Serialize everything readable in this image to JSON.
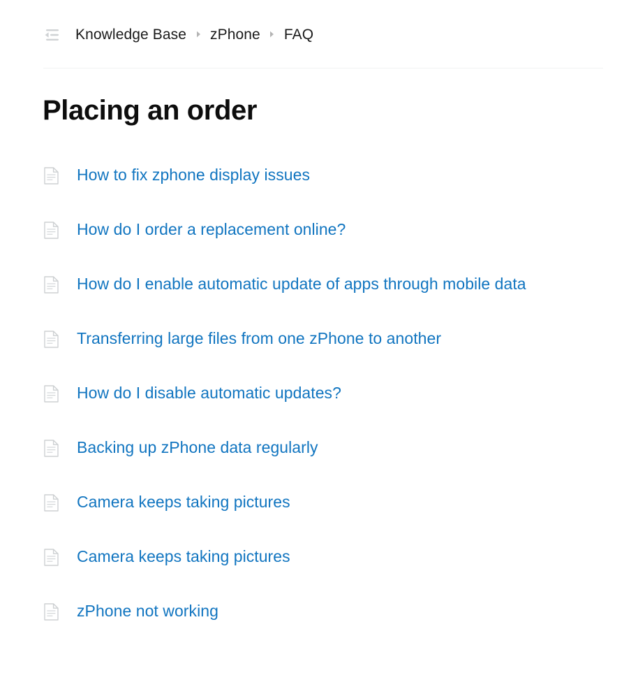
{
  "colors": {
    "link": "#1175c0",
    "text": "#1a1a1a",
    "title": "#0d0d0d",
    "icon_gray": "#c9ccce",
    "divider": "#f1f2f3",
    "separator": "#b3b3b3"
  },
  "header": {
    "sidebar_toggle_icon": "collapse-sidebar-icon",
    "breadcrumb": [
      {
        "label": "Knowledge Base"
      },
      {
        "label": "zPhone"
      },
      {
        "label": "FAQ"
      }
    ],
    "breadcrumb_separator": "chevron-right-icon"
  },
  "main": {
    "title": "Placing an order",
    "articles": [
      {
        "icon": "document-icon",
        "label": "How to fix zphone display issues"
      },
      {
        "icon": "document-icon",
        "label": "How do I order a replacement online?"
      },
      {
        "icon": "document-icon",
        "label": "How do I enable automatic update of apps through mobile data"
      },
      {
        "icon": "document-icon",
        "label": "Transferring large files from one zPhone to another"
      },
      {
        "icon": "document-icon",
        "label": "How do I disable automatic updates?"
      },
      {
        "icon": "document-icon",
        "label": "Backing up zPhone data regularly"
      },
      {
        "icon": "document-icon",
        "label": "Camera keeps taking pictures"
      },
      {
        "icon": "document-icon",
        "label": "Camera keeps taking pictures"
      },
      {
        "icon": "document-icon",
        "label": "zPhone not working"
      }
    ]
  }
}
